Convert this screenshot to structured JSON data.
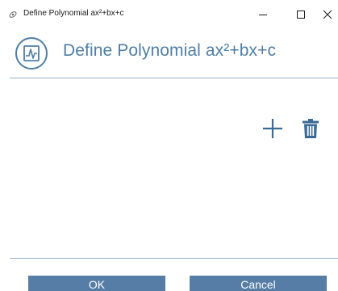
{
  "window": {
    "title": "Define Polynomial ax²+bx+c",
    "icon": "app-icon",
    "controls": {
      "minimize_icon": "minimize-icon",
      "maximize_icon": "maximize-icon",
      "close_icon": "close-icon"
    }
  },
  "header": {
    "title": "Define Polynomial ax²+bx+c",
    "icon": "chart-icon",
    "color": "#4f7ea6"
  },
  "actions": {
    "add_icon": "plus-icon",
    "delete_icon": "trash-icon"
  },
  "footer": {
    "ok_label": "OK",
    "cancel_label": "Cancel",
    "button_color": "#557da6"
  }
}
